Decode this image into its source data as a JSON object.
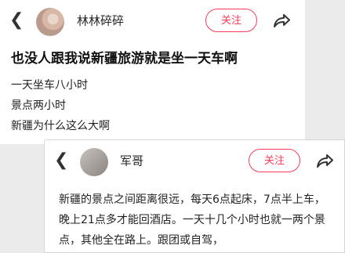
{
  "post1": {
    "username": "林林碎碎",
    "follow_label": "关注",
    "title": "也没人跟我说新疆旅游就是坐一天车啊",
    "lines": [
      "一天坐车八小时",
      "景点两小时",
      "新疆为什么这么大啊"
    ]
  },
  "post2": {
    "username": "军哥",
    "follow_label": "关注",
    "body": "新疆的景点之间距离很远，每天6点起床，7点半上车，晚上21点多才能回酒店。一天十几个小时也就一两个景点，其他全在路上。跟团或自驾，"
  },
  "colors": {
    "accent": "#ff3b57"
  },
  "icons": {
    "back": "chevron-left-icon",
    "share": "share-arrow-icon"
  }
}
